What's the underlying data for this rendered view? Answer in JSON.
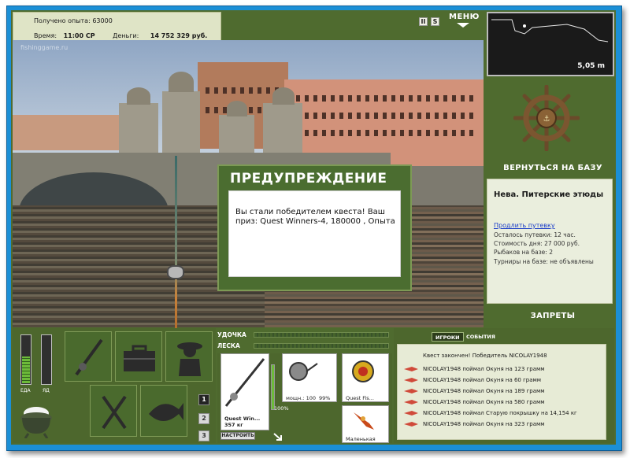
{
  "info": {
    "experience_label": "Получено опыта:",
    "experience_value": "63000",
    "time_label": "Время:",
    "time_value": "11:00 СР",
    "money_label": "Деньги:",
    "money_value": "14 752 329 руб."
  },
  "top": {
    "pause_icon": "II",
    "settings_icon": "S",
    "menu_label": "МЕНЮ"
  },
  "scene": {
    "watermark": "fishinggame.ru"
  },
  "dialog": {
    "title": "ПРЕДУПРЕЖДЕНИЕ",
    "message": "Вы стали победителем квеста! Ваш приз: Quest Winners-4, 180000 , Опыта"
  },
  "map": {
    "depth": "5,05 m"
  },
  "right": {
    "return_label": "ВЕРНУТЬСЯ НА БАЗУ",
    "location_title": "Нева. Питерские этюды",
    "extend_link": "Продлить путевку",
    "lines": [
      "Осталось путевки: 12 час.",
      "Стоимость дня: 27 000 руб.",
      "Рыбаков на базе: 2",
      "Турниры на базе: не объявлены"
    ],
    "bans_label": "ЗАПРЕТЫ"
  },
  "gauges": {
    "food_label": "ЕДА",
    "poison_label": "ЯД",
    "food_level": 0.55,
    "poison_level": 0.0
  },
  "pages": [
    "1",
    "2",
    "3"
  ],
  "tackle": {
    "rod_label": "УДОЧКА",
    "line_label": "ЛЕСКА",
    "rod_name": "Quest Win...",
    "rod_weight": "357 кг",
    "rod_condition": "100%",
    "reel_stats": "мощн.: 100",
    "reel_condition": "99%",
    "bait1_name": "Quest Fis...",
    "bait2_name": "Маленькая",
    "setup_label": "НАСТРОИТЬ"
  },
  "events": {
    "tab_players": "ИГРОКИ",
    "tab_events": "СОБЫТИЯ",
    "items": [
      "Квест закончен! Победитель NICOLAY1948",
      "NICOLAY1948 поймал Окуня на 123 грамм",
      "NICOLAY1948 поймал Окуня на 60 грамм",
      "NICOLAY1948 поймал Окуня на 189 грамм",
      "NICOLAY1948 поймал Окуня на 580 грамм",
      "NICOLAY1948 поймал Старую покрышку на 14,154 кг",
      "NICOLAY1948 поймал Окуня на 323 грамм"
    ]
  },
  "colors": {
    "panel_green": "#4f6b2f",
    "frame_blue": "#1b8fd6",
    "gauge_green": "#6dbb3a"
  }
}
